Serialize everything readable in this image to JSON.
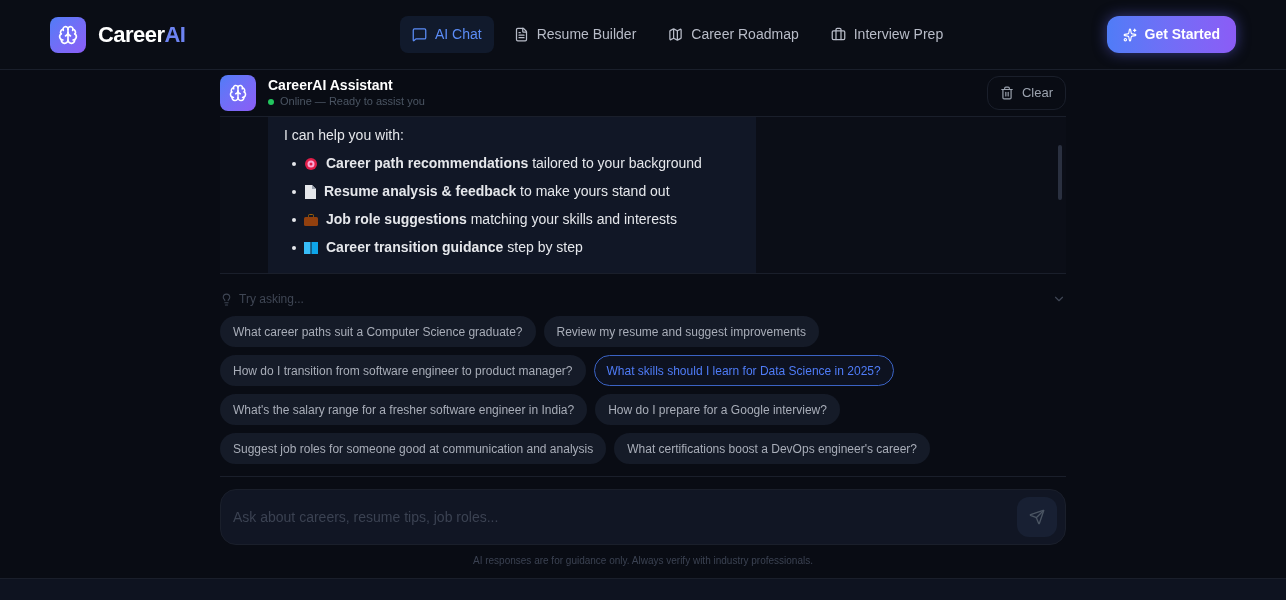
{
  "nav": {
    "brand": {
      "first": "Career",
      "second": "AI"
    },
    "tabs": [
      {
        "label": "AI Chat",
        "selected": true
      },
      {
        "label": "Resume Builder",
        "selected": false
      },
      {
        "label": "Career Roadmap",
        "selected": false
      },
      {
        "label": "Interview Prep",
        "selected": false
      }
    ],
    "cta": "Get Started"
  },
  "chat_header": {
    "title": "CareerAI Assistant",
    "status": "Online — Ready to assist you",
    "online": true,
    "clear": "Clear"
  },
  "message": {
    "intro": "I can help you with:",
    "items": [
      {
        "text": "**Career path recommendations** tailored to your background"
      },
      {
        "text": "**Resume analysis & feedback** to make yours stand out"
      },
      {
        "text": "**Job role suggestions** matching your skills and interests"
      },
      {
        "text": "**Career transition guidance** step by step"
      }
    ]
  },
  "suggestions": {
    "label": "Try asking...",
    "expanded": true,
    "chips": [
      {
        "text": "What career paths suit a Computer Science graduate?",
        "selected": false
      },
      {
        "text": "Review my resume and suggest improvements",
        "selected": false
      },
      {
        "text": "How do I transition from software engineer to product manager?",
        "selected": false
      },
      {
        "text": "What skills should I learn for Data Science in 2025?",
        "selected": true
      },
      {
        "text": "What's the salary range for a fresher software engineer in India?",
        "selected": false
      },
      {
        "text": "How do I prepare for a Google interview?",
        "selected": false
      },
      {
        "text": "Suggest job roles for someone good at communication and analysis",
        "selected": false
      },
      {
        "text": "What certifications boost a DevOps engineer's career?",
        "selected": false
      }
    ]
  },
  "input": {
    "placeholder": "Ask about careers, resume tips, job roles..."
  },
  "disclaimer": "AI responses are for guidance only. Always verify with industry professionals."
}
